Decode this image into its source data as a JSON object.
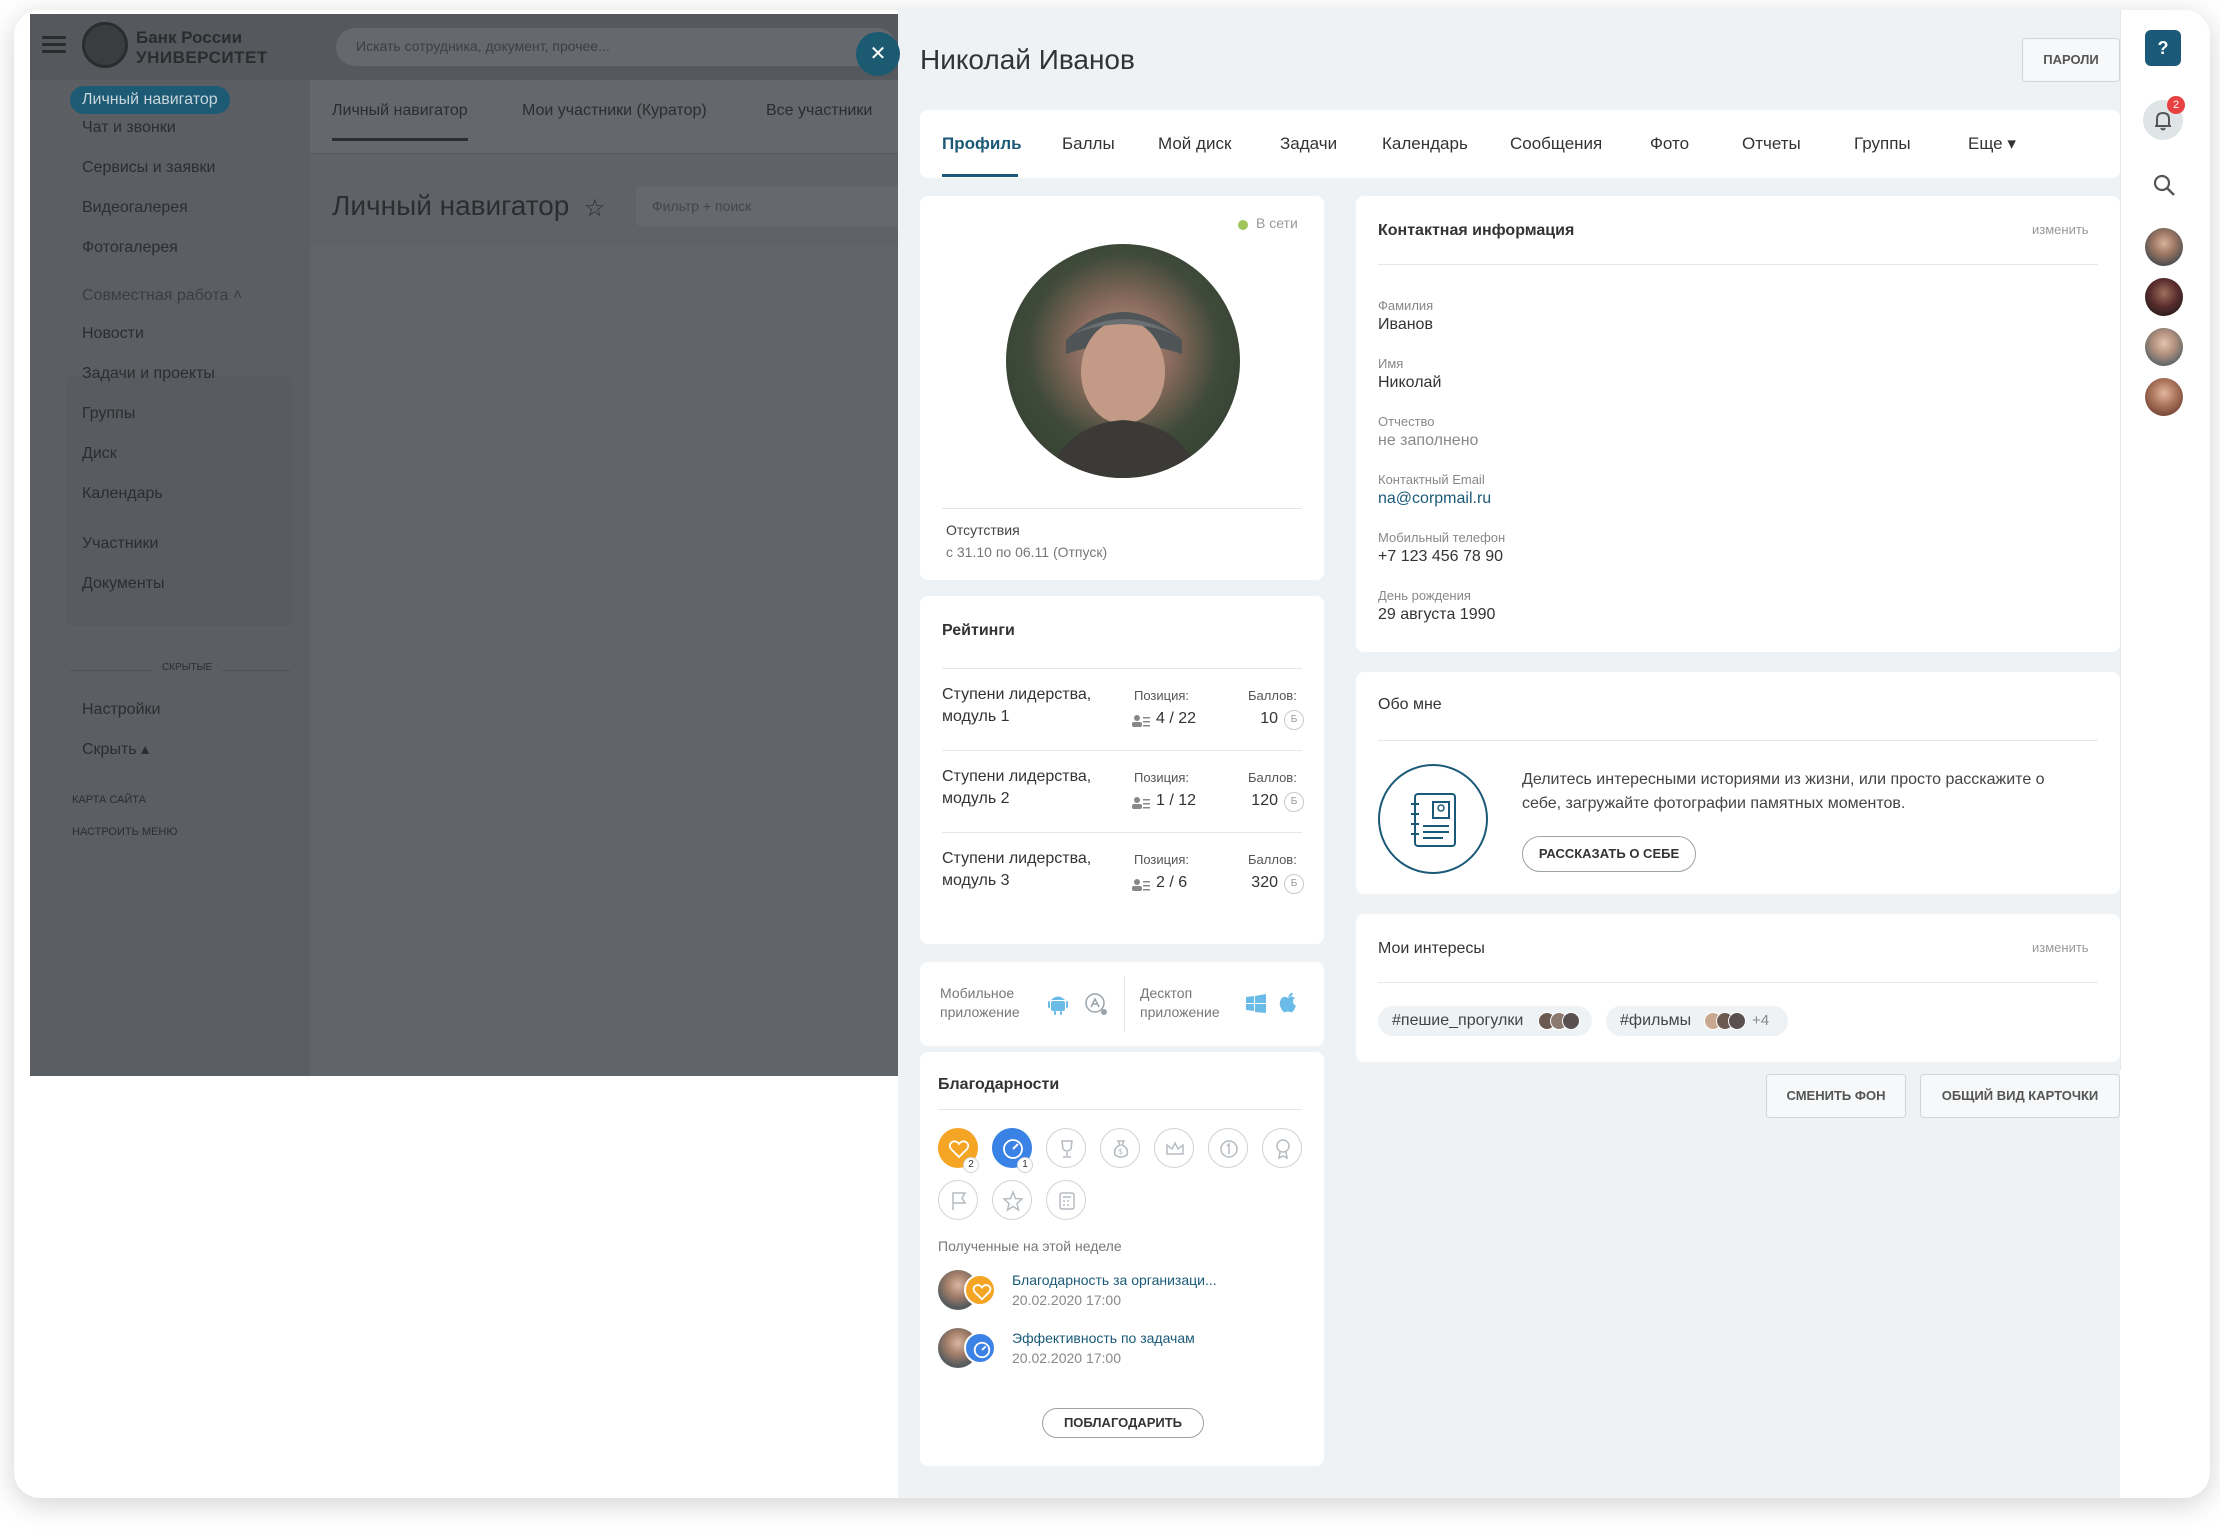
{
  "portal": {
    "logo_line1": "Банк России",
    "logo_line2": "УНИВЕРСИТЕТ",
    "search_placeholder": "Искать сотрудника, документ, прочее...",
    "menu": {
      "items": [
        {
          "label": "Личный навигатор",
          "active": true
        },
        {
          "label": "Чат и звонки"
        },
        {
          "label": "Сервисы и заявки"
        },
        {
          "label": "Видеогалерея"
        },
        {
          "label": "Фотогалерея"
        },
        {
          "label": "Совместная работа ˄"
        },
        {
          "label": "Новости"
        },
        {
          "label": "Задачи и проекты"
        },
        {
          "label": "Группы"
        },
        {
          "label": "Диск"
        },
        {
          "label": "Календарь"
        },
        {
          "label": "Участники"
        },
        {
          "label": "Документы"
        },
        {
          "label": "Настройки"
        },
        {
          "label": "Скрыть ▴"
        }
      ],
      "hidden_label": "СКРЫТЫЕ",
      "sitemap": "КАРТА САЙТА",
      "setup_menu": "НАСТРОИТЬ МЕНЮ"
    },
    "tabs": [
      "Личный навигатор",
      "Мои участники (Куратор)",
      "Все участники"
    ],
    "page_title": "Личный навигатор",
    "filter_placeholder": "Фильтр + поиск"
  },
  "profile": {
    "name": "Николай Иванов",
    "passwords_button": "ПАРОЛИ",
    "tabs": [
      "Профиль",
      "Баллы",
      "Мой диск",
      "Задачи",
      "Календарь",
      "Сообщения",
      "Фото",
      "Отчеты",
      "Группы",
      "Еще ▾"
    ],
    "status": "В сети",
    "absence_label": "Отсутствия",
    "absence_value": "с 31.10 по 06.11 (Отпуск)",
    "ratings": {
      "title": "Рейтинги",
      "position_label": "Позиция:",
      "score_label": "Баллов:",
      "b_label": "Б",
      "items": [
        {
          "name": "Ступени лидерства, модуль 1",
          "position": "4 / 22",
          "score": "10"
        },
        {
          "name": "Ступени лидерства, модуль 2",
          "position": "1 / 12",
          "score": "120"
        },
        {
          "name": "Ступени лидерства, модуль 3",
          "position": "2 / 6",
          "score": "320"
        }
      ]
    },
    "apps": {
      "mobile_label": "Мобильное приложение",
      "desktop_label": "Десктоп приложение"
    },
    "thanks": {
      "title": "Благодарности",
      "badge_counts": [
        "2",
        "1"
      ],
      "week_label": "Полученные на этой неделе",
      "items": [
        {
          "title": "Благодарность за организаци...",
          "date": "20.02.2020 17:00"
        },
        {
          "title": "Эффективность по задачам",
          "date": "20.02.2020 17:00"
        }
      ],
      "button": "ПОБЛАГОДАРИТЬ"
    },
    "contacts": {
      "title": "Контактная информация",
      "edit": "изменить",
      "fields": [
        {
          "label": "Фамилия",
          "value": "Иванов"
        },
        {
          "label": "Имя",
          "value": "Николай"
        },
        {
          "label": "Отчество",
          "value": "не заполнено"
        },
        {
          "label": "Контактный Email",
          "value": "na@corpmail.ru"
        },
        {
          "label": "Мобильный телефон",
          "value": "+7 123 456 78 90"
        },
        {
          "label": "День рождения",
          "value": "29 августа 1990"
        }
      ]
    },
    "about": {
      "title": "Обо мне",
      "text": "Делитесь интересными историями из жизни, или просто расскажите о себе, загружайте фотографии памятных моментов.",
      "button": "РАССКАЗАТЬ О СЕБЕ"
    },
    "interests": {
      "title": "Мои интересы",
      "edit": "изменить",
      "tags": [
        {
          "label": "#пешие_прогулки"
        },
        {
          "label": "#фильмы",
          "more": "+4"
        }
      ]
    },
    "change_bg_button": "СМЕНИТЬ ФОН",
    "card_view_button": "ОБЩИЙ ВИД КАРТОЧКИ"
  },
  "rightbar": {
    "help": "?",
    "notifications": "2"
  }
}
